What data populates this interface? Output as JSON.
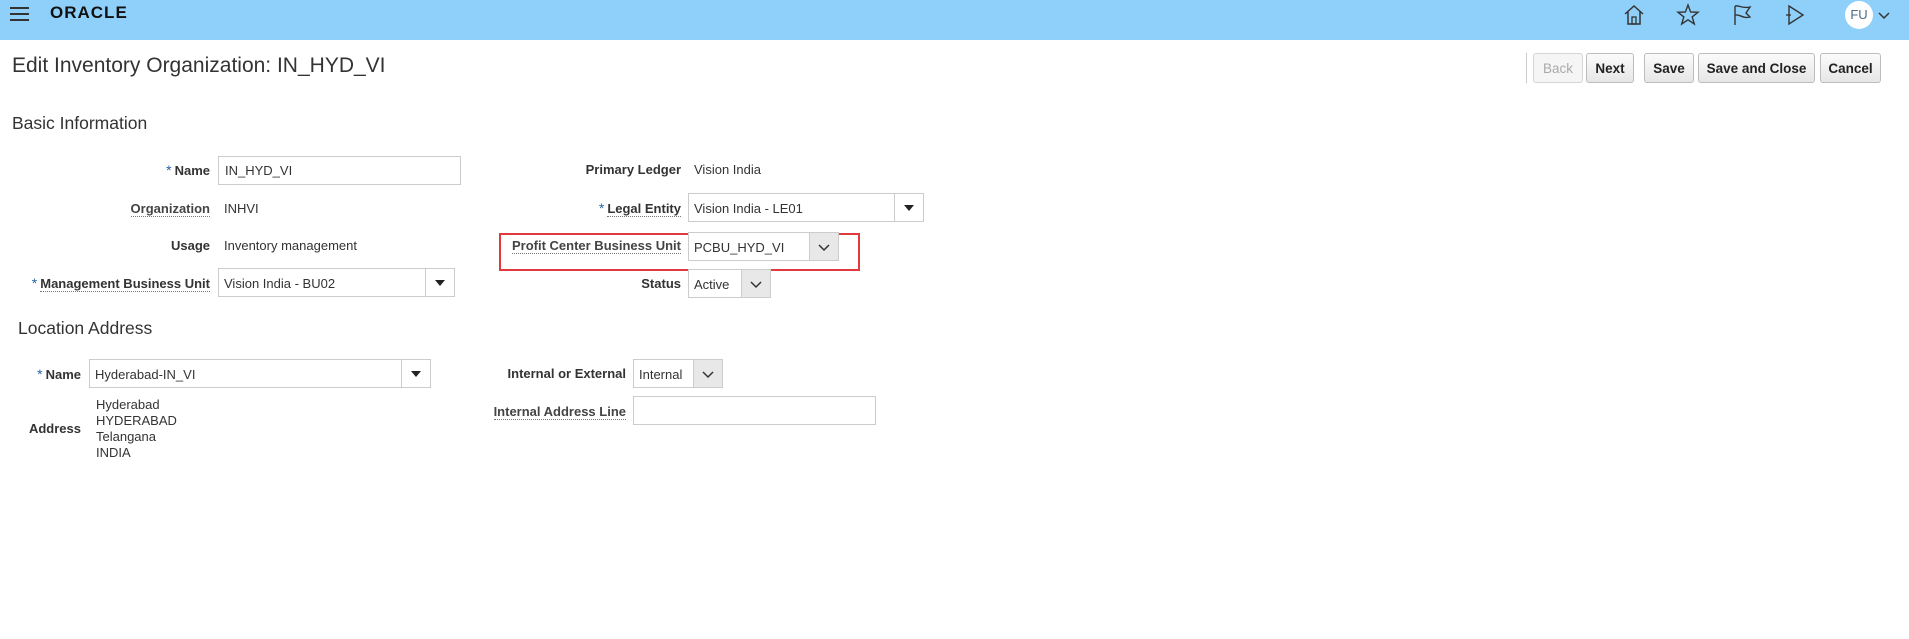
{
  "header": {
    "logo": "ORACLE",
    "avatar_initials": "FU",
    "icons": [
      "menu-icon",
      "home-icon",
      "star-icon",
      "flag-icon",
      "play-icon"
    ],
    "background_color": "#8fd0fb"
  },
  "page": {
    "title": "Edit Inventory Organization: IN_HYD_VI"
  },
  "toolbar": {
    "back": "Back",
    "next": "Next",
    "save": "Save",
    "save_close": "Save and Close",
    "cancel": "Cancel"
  },
  "basic": {
    "title": "Basic Information",
    "name_label": "Name",
    "name_value": "IN_HYD_VI",
    "organization_label": "Organization",
    "organization_value": "INHVI",
    "usage_label": "Usage",
    "usage_value": "Inventory management",
    "mbu_label": "Management Business Unit",
    "mbu_value": "Vision India - BU02",
    "primary_ledger_label": "Primary Ledger",
    "primary_ledger_value": "Vision India",
    "legal_entity_label": "Legal Entity",
    "legal_entity_value": "Vision India - LE01",
    "pcbu_label": "Profit Center Business Unit",
    "pcbu_value": "PCBU_HYD_VI",
    "status_label": "Status",
    "status_value": "Active"
  },
  "location": {
    "title": "Location Address",
    "name_label": "Name",
    "name_value": "Hyderabad-IN_VI",
    "address_label": "Address",
    "address_lines": [
      "Hyderabad",
      "HYDERABAD",
      "Telangana",
      "INDIA"
    ],
    "internal_external_label": "Internal or External",
    "internal_external_value": "Internal",
    "internal_address_label": "Internal Address Line",
    "internal_address_value": ""
  },
  "required_marker": "*",
  "highlight_color": "#e0393e"
}
